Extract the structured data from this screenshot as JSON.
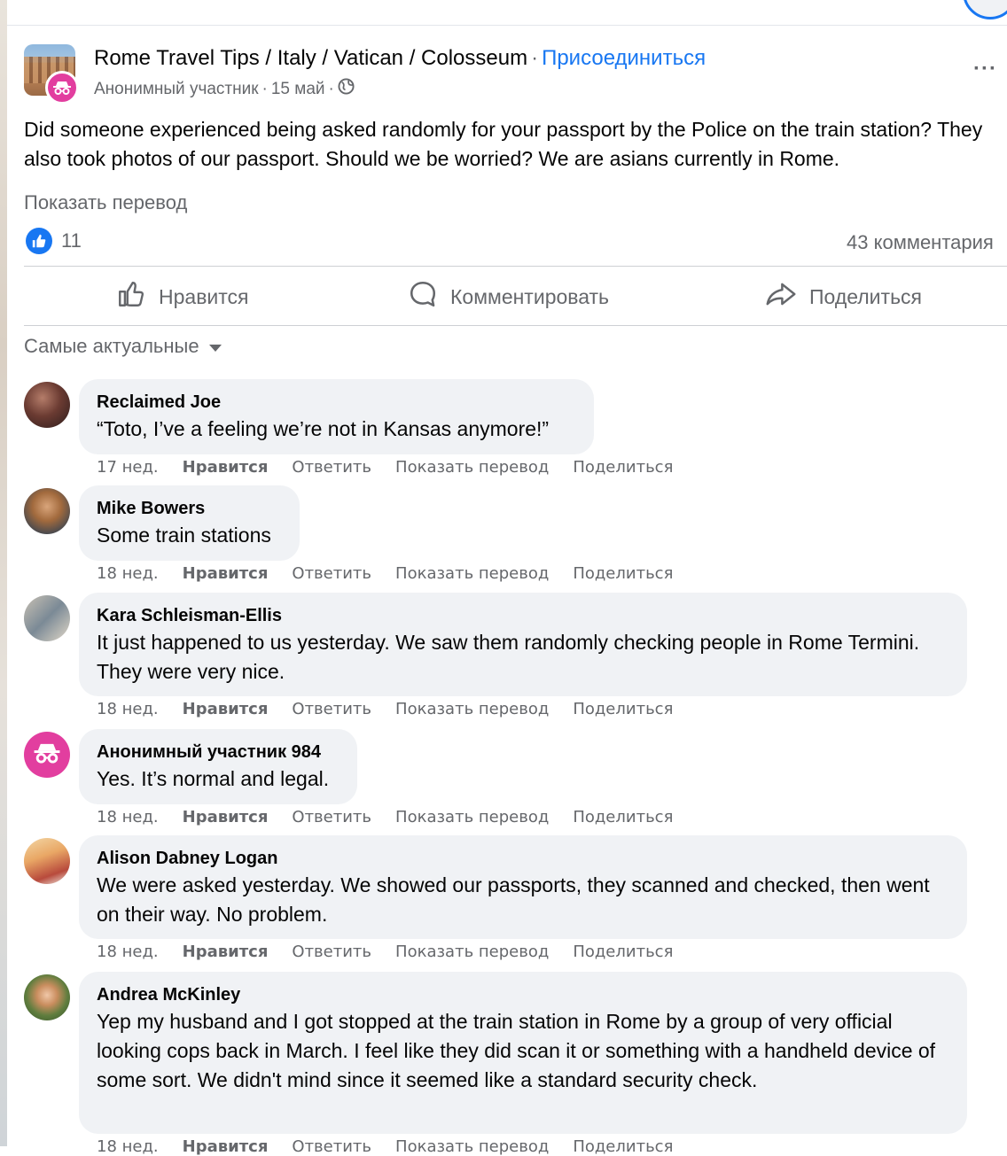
{
  "group": {
    "name": "Rome Travel Tips / Italy / Vatican / Colosseum",
    "separator": "·",
    "join_label": "Присоединиться",
    "author": "Анонимный участник",
    "date": "15 май",
    "more_label": "···"
  },
  "post": {
    "text": "Did someone experienced being asked randomly for your passport by the Police on the train station? They also took photos of our passport. Should we be worried? We are asians currently in Rome.",
    "translate_label": "Показать перевод",
    "like_count": "11",
    "comment_count": "43 комментария"
  },
  "actions": {
    "like": "Нравится",
    "comment": "Комментировать",
    "share": "Поделиться"
  },
  "sort_label": "Самые актуальные",
  "comment_actions": {
    "like": "Нравится",
    "reply": "Ответить",
    "translate": "Показать перевод",
    "share": "Поделиться"
  },
  "comments": [
    {
      "author": "Reclaimed Joe",
      "text": "“Toto, I’ve a feeling we’re not in Kansas anymore!”",
      "time": "17 нед."
    },
    {
      "author": "Mike Bowers",
      "text": "Some train stations",
      "time": "18 нед."
    },
    {
      "author": "Kara Schleisman-Ellis",
      "text": "It just happened to us yesterday. We saw them randomly checking people in Rome Termini. They were very nice.",
      "time": "18 нед."
    },
    {
      "author": "Анонимный участник 984",
      "text": "Yes. It’s normal and legal.",
      "time": "18 нед."
    },
    {
      "author": "Alison Dabney Logan",
      "text": "We were asked yesterday. We showed our passports, they scanned and checked, then went on their way. No problem.",
      "time": "18 нед."
    },
    {
      "author": "Andrea McKinley",
      "text": "Yep my husband and I got stopped at the train station in Rome by a group of very official looking cops back in March. I feel like they did scan it or something with a handheld device of some sort. We didn't mind since it seemed like a standard security check.",
      "time": "18 нед."
    }
  ]
}
